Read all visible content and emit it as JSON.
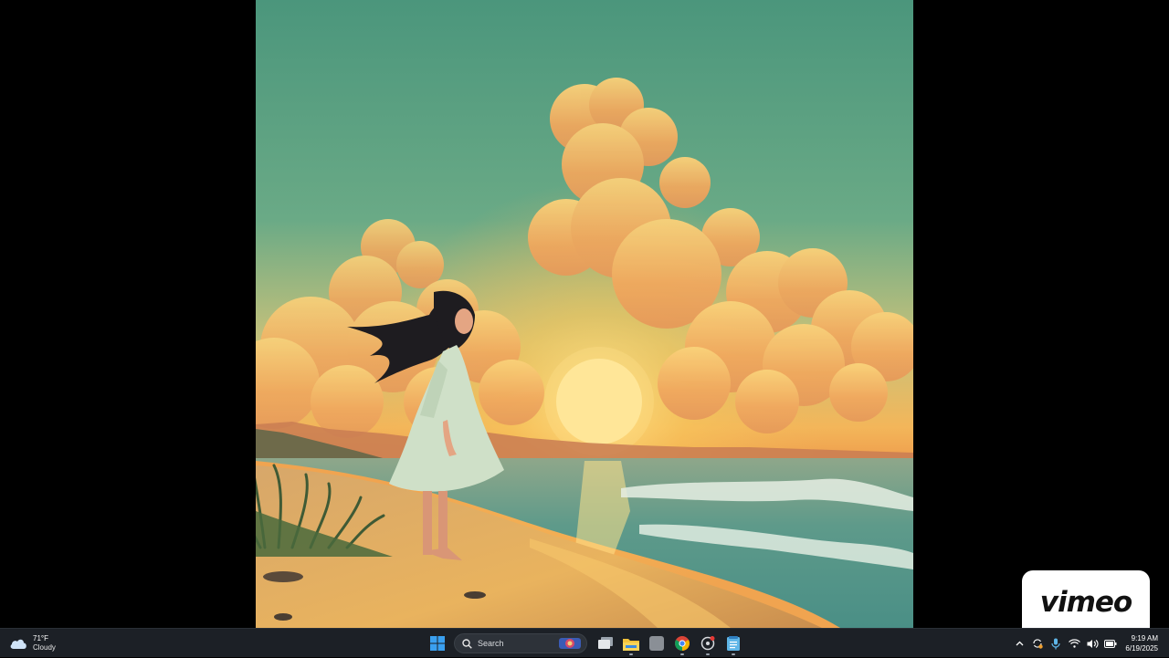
{
  "weather": {
    "temperature": "71°F",
    "condition": "Cloudy",
    "icon": "cloud-icon"
  },
  "search": {
    "label": "Search"
  },
  "taskbar_apps": [
    {
      "name": "start-button",
      "icon": "windows-logo-icon"
    },
    {
      "name": "task-view-button",
      "icon": "task-view-icon"
    },
    {
      "name": "file-explorer-button",
      "icon": "folder-icon"
    },
    {
      "name": "app-button",
      "icon": "gray-app-icon"
    },
    {
      "name": "chrome-button",
      "icon": "chrome-icon"
    },
    {
      "name": "recorder-button",
      "icon": "record-icon"
    },
    {
      "name": "notepad-button",
      "icon": "notepad-icon"
    }
  ],
  "tray": {
    "icons": [
      "chevron-up-icon",
      "sync-icon",
      "microphone-icon",
      "wifi-icon",
      "volume-icon",
      "battery-icon"
    ],
    "time": "9:19 AM",
    "date": "6/19/2025"
  },
  "watermark": {
    "text": "vimeo"
  },
  "colors": {
    "sky_top": "#4e9a80",
    "sunset_gold": "#f4c055",
    "taskbar_bg": "#1c2026",
    "accent_blue": "#3aa0f0"
  }
}
